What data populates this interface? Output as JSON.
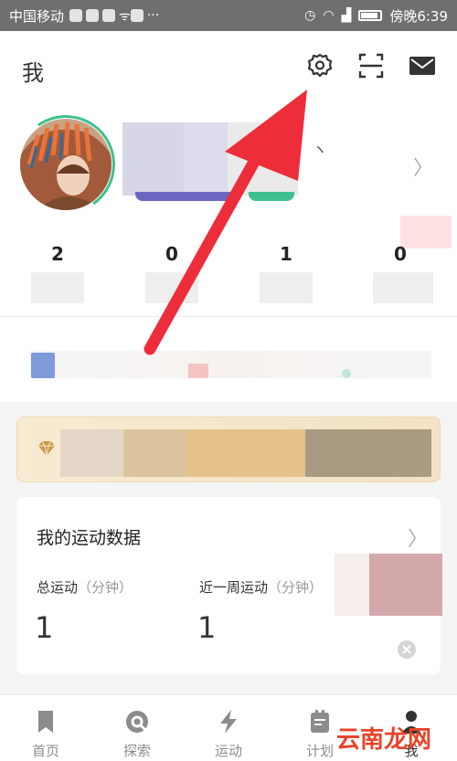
{
  "status_bar": {
    "carrier": "中国移动",
    "time": "傍晚6:39"
  },
  "header": {
    "title": "我"
  },
  "profile": {
    "stats": [
      {
        "value": "2"
      },
      {
        "value": "0"
      },
      {
        "value": "1"
      },
      {
        "value": "0"
      }
    ]
  },
  "sport_card": {
    "title": "我的运动数据",
    "total_label": "总运动",
    "total_unit": "（分钟）",
    "total_value": "1",
    "week_label": "近一周运动",
    "week_unit": "（分钟）",
    "week_value": "1"
  },
  "tabbar": {
    "tabs": [
      {
        "label": "首页",
        "icon": "bookmark-icon"
      },
      {
        "label": "探索",
        "icon": "explore-icon"
      },
      {
        "label": "运动",
        "icon": "lightning-icon"
      },
      {
        "label": "计划",
        "icon": "plan-icon"
      },
      {
        "label": "我",
        "icon": "me-icon"
      }
    ]
  },
  "watermark": {
    "text": "云南龙网"
  },
  "colors": {
    "accent_green": "#3ec08e",
    "accent_purple": "#6c68c0",
    "arrow_red": "#ee2d3a",
    "vip_gold": "#e5c28c"
  }
}
